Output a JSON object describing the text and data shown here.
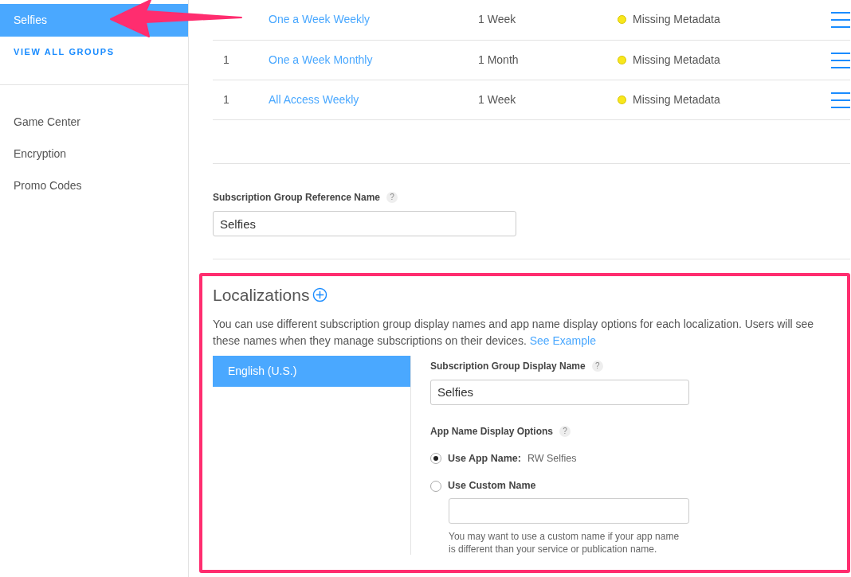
{
  "sidebar": {
    "groups": [
      {
        "label": "Selfies",
        "selected": true
      }
    ],
    "view_all": "VIEW ALL GROUPS",
    "items": [
      {
        "label": "Game Center"
      },
      {
        "label": "Encryption"
      },
      {
        "label": "Promo Codes"
      }
    ]
  },
  "table": {
    "rows": [
      {
        "name": "One a Week Weekly",
        "duration": "1 Week",
        "status": "Missing Metadata",
        "color": "#f8e71c"
      },
      {
        "count": "1",
        "name": "One a Week Monthly",
        "duration": "1 Month",
        "status": "Missing Metadata",
        "color": "#f8e71c"
      },
      {
        "count": "1",
        "name": "All Access Weekly",
        "duration": "1 Week",
        "status": "Missing Metadata",
        "color": "#f8e71c"
      }
    ]
  },
  "reference_name": {
    "label": "Subscription Group Reference Name",
    "help": "?",
    "value": "Selfies"
  },
  "localizations": {
    "title": "Localizations",
    "description": "You can use different subscription group display names and app name display options for each localization. Users will see these names when they manage subscriptions on their devices.",
    "link": "See Example",
    "languages": [
      {
        "label": "English (U.S.)",
        "selected": true
      }
    ],
    "display_name": {
      "label": "Subscription Group Display Name",
      "help": "?",
      "value": "Selfies"
    },
    "app_name_options": {
      "label": "App Name Display Options",
      "help": "?",
      "options": [
        {
          "label": "Use App Name:",
          "detail": "RW Selfies",
          "selected": true
        },
        {
          "label": "Use Custom Name",
          "selected": false
        }
      ],
      "custom_hint": "You may want to use a custom name if your app name is different than your service or publication name."
    }
  }
}
